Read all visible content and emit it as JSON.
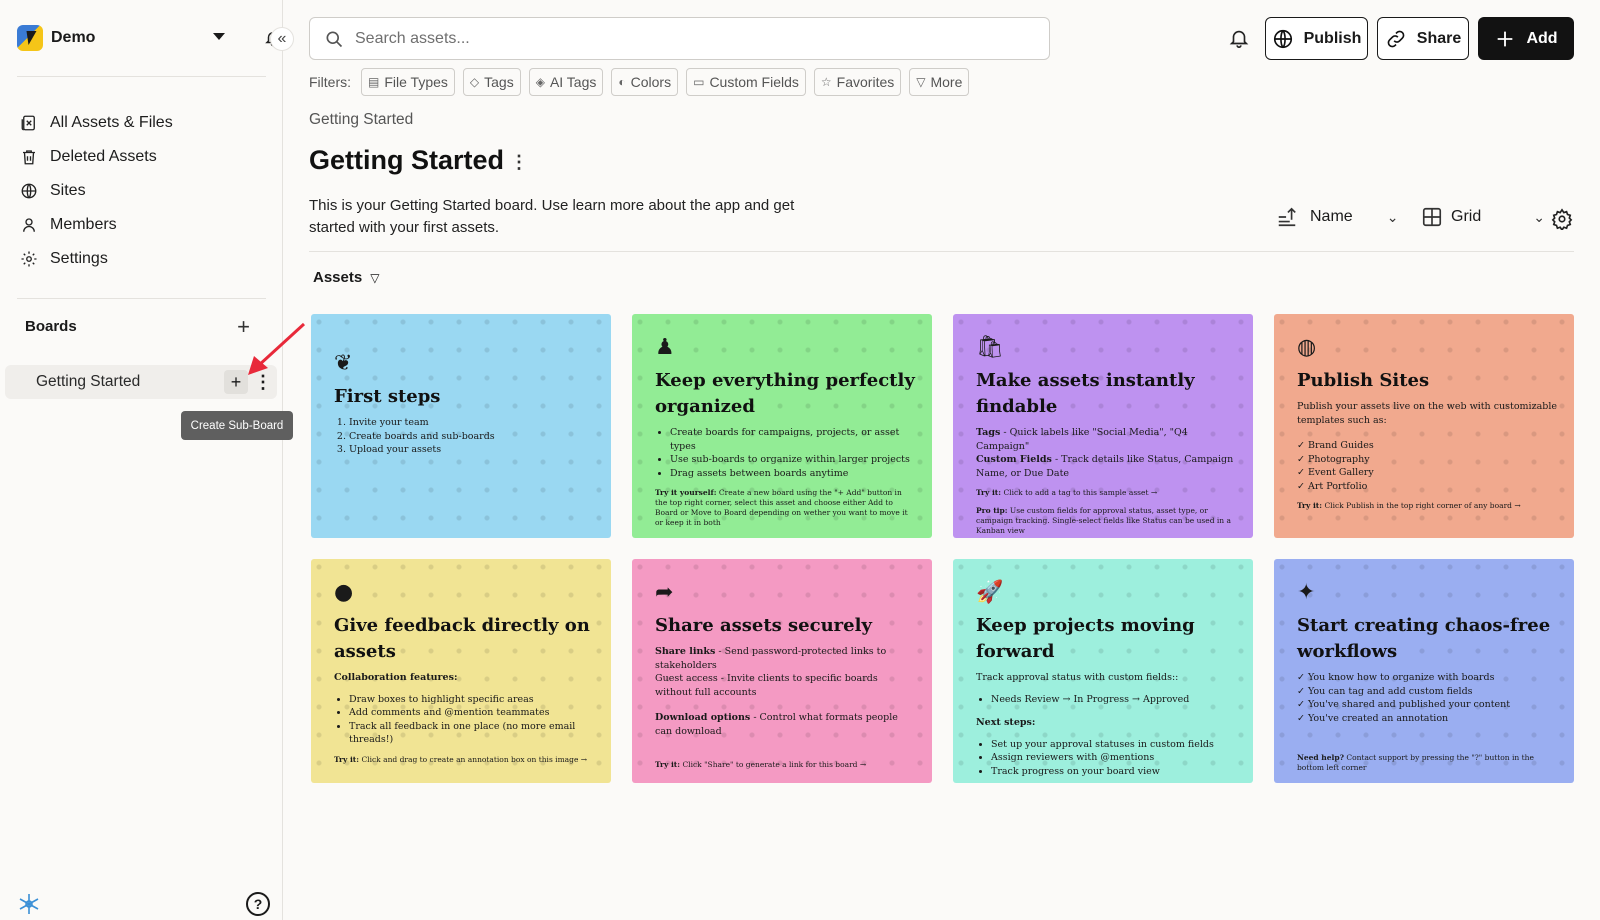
{
  "workspace": {
    "name": "Demo"
  },
  "sidebar": {
    "nav": [
      {
        "label": "All Assets & Files",
        "icon": "files-icon"
      },
      {
        "label": "Deleted Assets",
        "icon": "trash-icon"
      },
      {
        "label": "Sites",
        "icon": "globe-icon"
      },
      {
        "label": "Members",
        "icon": "person-icon"
      },
      {
        "label": "Settings",
        "icon": "gear-icon"
      }
    ],
    "boards_title": "Boards",
    "boards": [
      {
        "label": "Getting Started"
      }
    ],
    "tooltip": "Create Sub-Board"
  },
  "search": {
    "placeholder": "Search assets..."
  },
  "toolbar": {
    "publish": "Publish",
    "share": "Share",
    "add": "Add"
  },
  "filters": {
    "label": "Filters:",
    "chips": [
      "File Types",
      "Tags",
      "AI Tags",
      "Colors",
      "Custom Fields",
      "Favorites",
      "More"
    ]
  },
  "page": {
    "breadcrumb": "Getting Started",
    "title": "Getting Started",
    "description": "This is your Getting Started board. Use learn more about the app and get started with your first assets.",
    "sort_label": "Name",
    "view_label": "Grid",
    "section": "Assets"
  },
  "cards": [
    {
      "icon": "❦",
      "title": "First steps",
      "list": [
        "Invite your team",
        "Create boards and sub-boards",
        "Upload your assets"
      ]
    },
    {
      "icon": "♟",
      "title": "Keep everything perfectly organized",
      "list": [
        "Create boards for campaigns, projects, or asset types",
        "Use sub-boards to organize within larger projects",
        "Drag assets between boards anytime"
      ],
      "tip_bold": "Try it yourself:",
      "tip": "Create a new board using the \"+ Add\" button in the top right corner, select this asset and choose either Add to Board or Move to Board depending on wether you want to move it or keep it in both"
    },
    {
      "icon": "🛍",
      "title": "Make assets instantly findable",
      "l1_bold": "Tags",
      "l1": "- Quick labels like \"Social Media\", \"Q4 Campaign\"",
      "l2_bold": "Custom Fields",
      "l2": "- Track details like Status, Campaign Name, or Due Date",
      "tip_bold": "Try it:",
      "tip": "Click to add a tag to this sample asset →",
      "tip2_bold": "Pro tip:",
      "tip2": "Use custom fields for approval status, asset type, or campaign tracking. Single-select fields like Status can be used in a Kanban view"
    },
    {
      "icon": "◍",
      "title": "Publish Sites",
      "intro": "Publish your assets live on the web with customizable templates such as:",
      "list": [
        "✓ Brand Guides",
        "✓ Photography",
        "✓ Event Gallery",
        "✓ Art Portfolio"
      ],
      "tip_bold": "Try it:",
      "tip": "Click Publish in the top right corner of any board →"
    },
    {
      "icon": "●",
      "title": "Give feedback directly on assets",
      "intro_bold": "Collaboration features:",
      "list": [
        "Draw boxes to highlight specific areas",
        "Add comments and @mention teammates",
        "Track all feedback in one place (no more email threads!)"
      ],
      "tip_bold": "Try it:",
      "tip": "Click and drag to create an annotation box on this image →"
    },
    {
      "icon": "➦",
      "title": "Share assets securely",
      "l1_bold": "Share links",
      "l1": "- Send password-protected links to stakeholders",
      "l2": "Guest access - Invite clients to specific boards without full accounts",
      "l3_bold": "Download options",
      "l3": "- Control what formats people can download",
      "tip_bold": "Try it:",
      "tip": "Click \"Share\" to generate a link for this board →"
    },
    {
      "icon": "🚀",
      "title": "Keep projects moving forward",
      "intro": "Track approval status with custom fields::",
      "list": [
        "Needs Review → In Progress → Approved"
      ],
      "next_bold": "Next steps:",
      "list2": [
        "Set up your approval statuses in custom fields",
        "Assign reviewers with @mentions",
        "Track progress on your board view"
      ]
    },
    {
      "icon": "✦",
      "title": "Start creating chaos-free workflows",
      "list": [
        "✓ You know how to organize with boards",
        "✓ You can tag and add custom fields",
        "✓ You've shared and published your content",
        "✓ You've created an annotation"
      ],
      "tip_bold": "Need help?",
      "tip": "Contact support by pressing the \"?\" button in the bottom left corner"
    }
  ]
}
